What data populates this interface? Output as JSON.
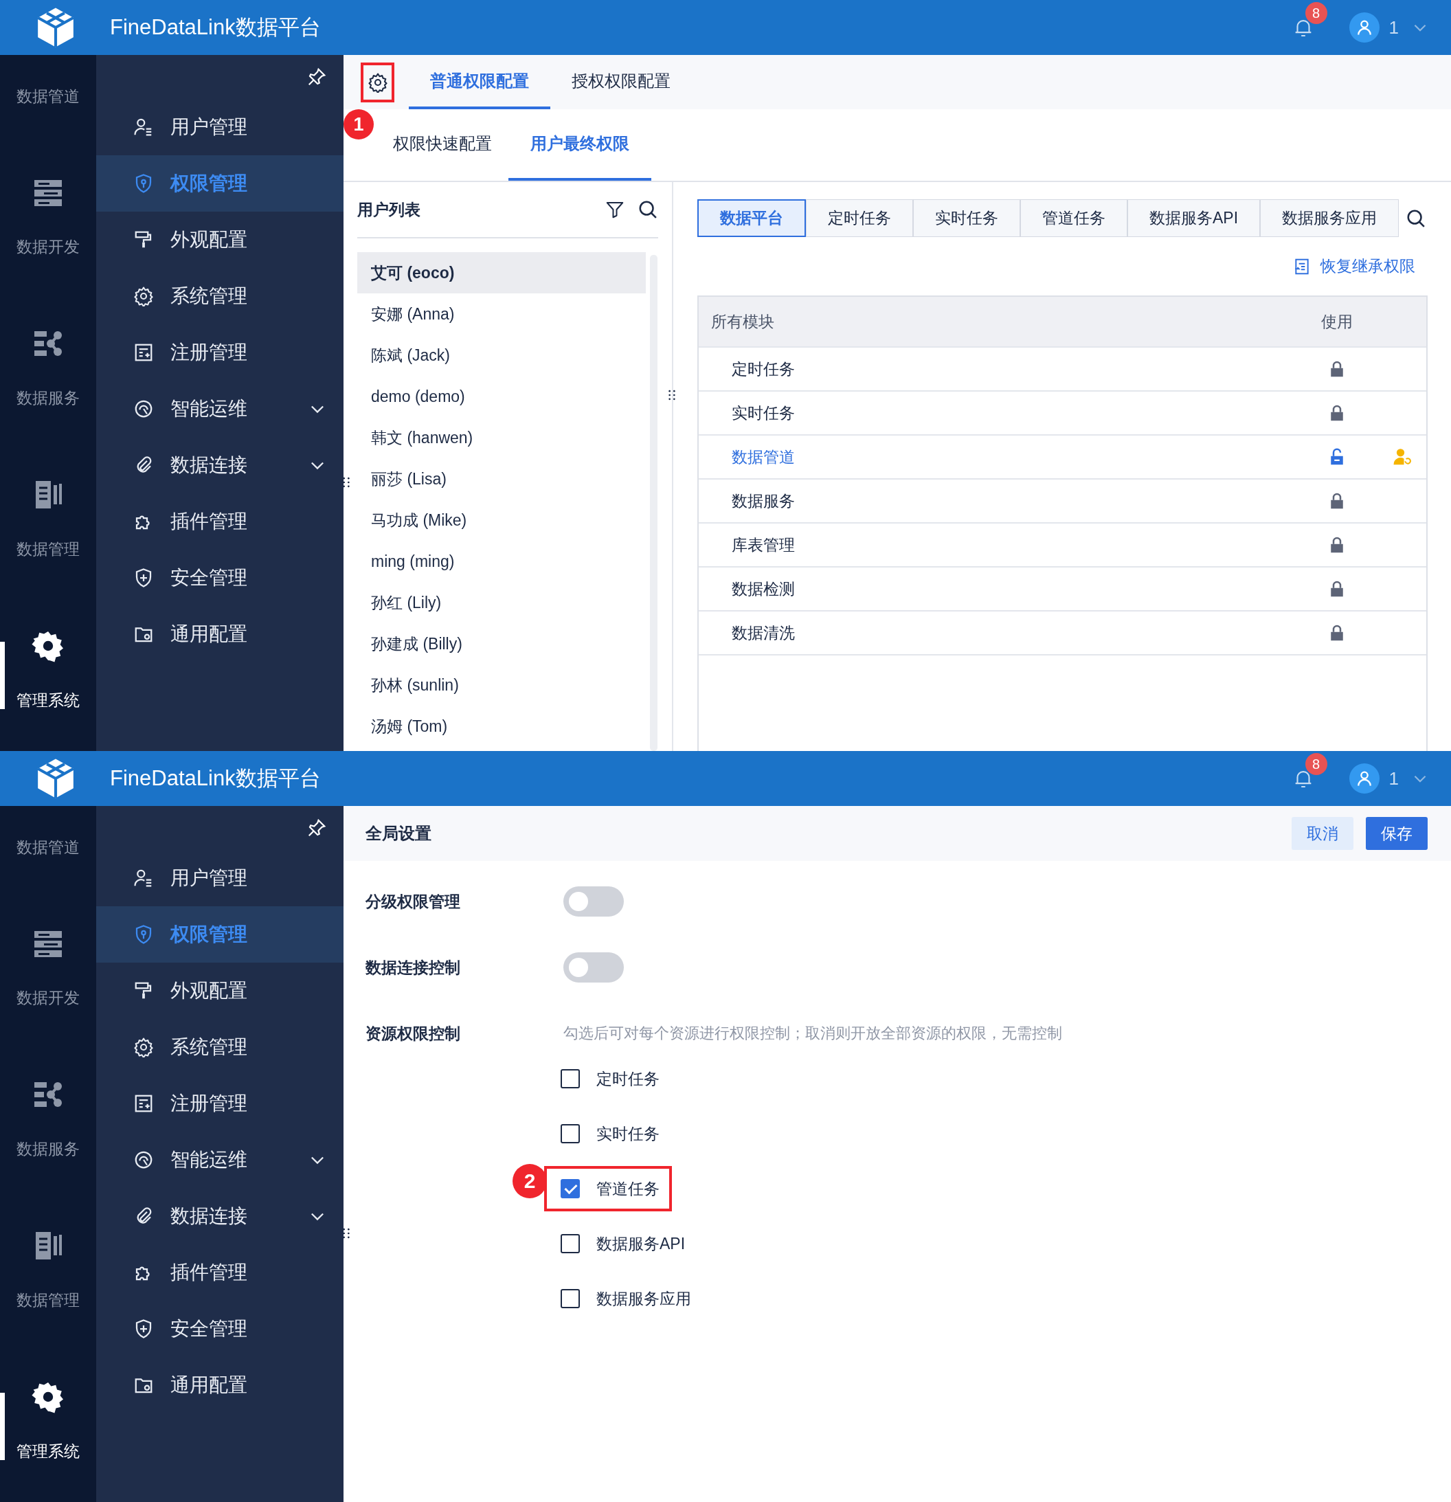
{
  "screens": [
    {
      "header": {
        "title": "FineDataLink数据平台",
        "notification_count": "8",
        "user": "1"
      },
      "rail": [
        {
          "label": "数据管道",
          "selected": false,
          "cut_off": true
        },
        {
          "label": "数据开发",
          "selected": false,
          "cut_off": false
        },
        {
          "label": "数据服务",
          "selected": false,
          "cut_off": false
        },
        {
          "label": "数据管理",
          "selected": false,
          "cut_off": false
        },
        {
          "label": "管理系统",
          "selected": true,
          "cut_off": false
        }
      ],
      "nav": {
        "items": [
          {
            "label": "用户管理",
            "kind": "item",
            "selected": false
          },
          {
            "label": "权限管理",
            "kind": "item",
            "selected": true
          },
          {
            "label": "外观配置",
            "kind": "item",
            "selected": false
          },
          {
            "label": "系统管理",
            "kind": "item",
            "selected": false
          },
          {
            "label": "注册管理",
            "kind": "item",
            "selected": false
          },
          {
            "label": "智能运维",
            "kind": "group",
            "expanded": false,
            "selected": false
          },
          {
            "label": "数据连接",
            "kind": "group",
            "expanded": false,
            "selected": false
          },
          {
            "label": "插件管理",
            "kind": "item",
            "selected": false
          },
          {
            "label": "安全管理",
            "kind": "item",
            "selected": false
          },
          {
            "label": "通用配置",
            "kind": "item",
            "selected": false
          }
        ]
      },
      "content": {
        "kind": "permissions",
        "settings_button": {
          "callout": "1"
        },
        "tabs": [
          {
            "label": "普通权限配置",
            "selected": true
          },
          {
            "label": "授权权限配置",
            "selected": false
          }
        ],
        "subtabs": [
          {
            "label": "权限快速配置",
            "selected": false
          },
          {
            "label": "用户最终权限",
            "selected": true
          }
        ],
        "user_list": {
          "title": "用户列表",
          "users": [
            {
              "name": "艾可 (eoco)",
              "selected": true
            },
            {
              "name": "安娜 (Anna)",
              "selected": false
            },
            {
              "name": "陈斌 (Jack)",
              "selected": false
            },
            {
              "name": "demo (demo)",
              "selected": false
            },
            {
              "name": "韩文 (hanwen)",
              "selected": false
            },
            {
              "name": "丽莎 (Lisa)",
              "selected": false
            },
            {
              "name": "马功成 (Mike)",
              "selected": false
            },
            {
              "name": "ming (ming)",
              "selected": false
            },
            {
              "name": "孙红 (Lily)",
              "selected": false
            },
            {
              "name": "孙建成 (Billy)",
              "selected": false
            },
            {
              "name": "孙林 (sunlin)",
              "selected": false
            },
            {
              "name": "汤姆 (Tom)",
              "selected": false
            }
          ]
        },
        "module_tabs": [
          {
            "label": "数据平台",
            "selected": true
          },
          {
            "label": "定时任务",
            "selected": false
          },
          {
            "label": "实时任务",
            "selected": false
          },
          {
            "label": "管道任务",
            "selected": false
          },
          {
            "label": "数据服务API",
            "selected": false
          },
          {
            "label": "数据服务应用",
            "selected": false
          }
        ],
        "restore_link": "恢复继承权限",
        "table": {
          "columns": [
            "所有模块",
            "使用"
          ],
          "rows": [
            {
              "module": "定时任务",
              "locked": true,
              "customized": false
            },
            {
              "module": "实时任务",
              "locked": true,
              "customized": false
            },
            {
              "module": "数据管道",
              "locked": false,
              "customized": true
            },
            {
              "module": "数据服务",
              "locked": true,
              "customized": false
            },
            {
              "module": "库表管理",
              "locked": true,
              "customized": false
            },
            {
              "module": "数据检测",
              "locked": true,
              "customized": false
            },
            {
              "module": "数据清洗",
              "locked": true,
              "customized": false
            }
          ]
        }
      }
    },
    {
      "header": {
        "title": "FineDataLink数据平台",
        "notification_count": "8",
        "user": "1"
      },
      "rail": [
        {
          "label": "数据管道",
          "selected": false,
          "cut_off": true
        },
        {
          "label": "数据开发",
          "selected": false,
          "cut_off": false
        },
        {
          "label": "数据服务",
          "selected": false,
          "cut_off": false
        },
        {
          "label": "数据管理",
          "selected": false,
          "cut_off": false
        },
        {
          "label": "管理系统",
          "selected": true,
          "cut_off": false
        }
      ],
      "nav": {
        "items": [
          {
            "label": "用户管理",
            "kind": "item",
            "selected": false
          },
          {
            "label": "权限管理",
            "kind": "item",
            "selected": true
          },
          {
            "label": "外观配置",
            "kind": "item",
            "selected": false
          },
          {
            "label": "系统管理",
            "kind": "item",
            "selected": false
          },
          {
            "label": "注册管理",
            "kind": "item",
            "selected": false
          },
          {
            "label": "智能运维",
            "kind": "group",
            "expanded": false,
            "selected": false
          },
          {
            "label": "数据连接",
            "kind": "group",
            "expanded": false,
            "selected": false
          },
          {
            "label": "插件管理",
            "kind": "item",
            "selected": false
          },
          {
            "label": "安全管理",
            "kind": "item",
            "selected": false
          },
          {
            "label": "通用配置",
            "kind": "item",
            "selected": false
          }
        ]
      },
      "content": {
        "kind": "settings",
        "title": "全局设置",
        "buttons": [
          {
            "label": "取消",
            "kind": "secondary"
          },
          {
            "label": "保存",
            "kind": "primary"
          }
        ],
        "rows": [
          {
            "label": "分级权限管理",
            "kind": "switch",
            "on": false
          },
          {
            "label": "数据连接控制",
            "kind": "switch",
            "on": false
          },
          {
            "label": "资源权限控制",
            "kind": "checklist",
            "hint": "勾选后可对每个资源进行权限控制；取消则开放全部资源的权限，无需控制",
            "options": [
              {
                "label": "定时任务",
                "checked": false,
                "highlighted": false
              },
              {
                "label": "实时任务",
                "checked": false,
                "highlighted": false
              },
              {
                "label": "管道任务",
                "checked": true,
                "highlighted": true,
                "callout": "2"
              },
              {
                "label": "数据服务API",
                "checked": false,
                "highlighted": false
              },
              {
                "label": "数据服务应用",
                "checked": false,
                "highlighted": false
              }
            ]
          }
        ]
      }
    }
  ]
}
